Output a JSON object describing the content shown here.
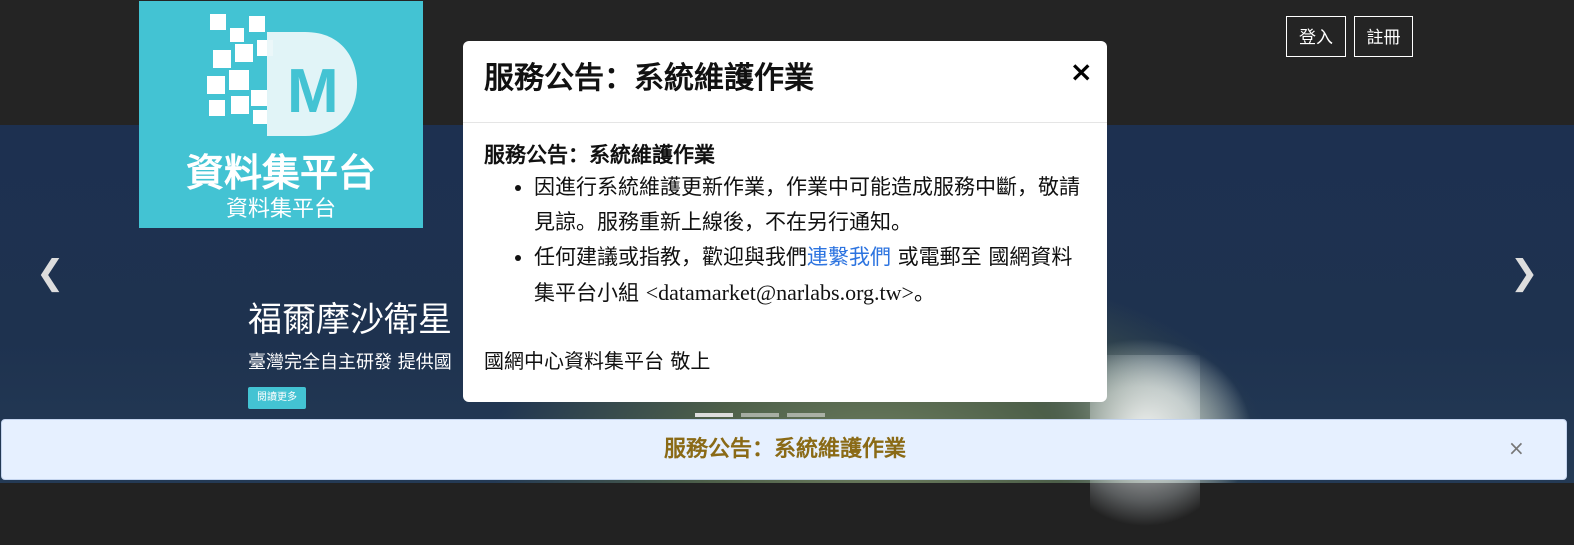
{
  "header": {
    "logo_title": "資料集平台",
    "logo_subtitle": "資料集平台",
    "logo_mark_letter": "M",
    "login_label": "登入",
    "register_label": "註冊"
  },
  "carousel": {
    "prev_glyph": "❮",
    "next_glyph": "❯",
    "slide_title": "福爾摩沙衛星",
    "slide_subtitle": "臺灣完全自主研發  提供國",
    "read_more_label": "閱讀更多"
  },
  "modal": {
    "title": "服務公告：系統維護作業",
    "close_glyph": "×",
    "body_heading": "服務公告：系統維護作業",
    "item1": "因進行系統維護更新作業，作業中可能造成服務中斷，敬請見諒。服務重新上線後，不在另行通知。",
    "item2_prefix": "任何建議或指教，歡迎與我們",
    "item2_link": "連繫我們",
    "item2_middle": " 或電郵至 國網資料集平台小組 ",
    "item2_email": "<datamarket@narlabs.org.tw>",
    "item2_suffix": "。",
    "signature": "國網中心資料集平台 敬上"
  },
  "notice_bar": {
    "text": "服務公告：系統維護作業",
    "close_glyph": "×"
  },
  "colors": {
    "brand_teal": "#43c3d3",
    "link_blue": "#2d74e0",
    "notice_text": "#8a6a16",
    "notice_bg": "#e6f0ff"
  }
}
